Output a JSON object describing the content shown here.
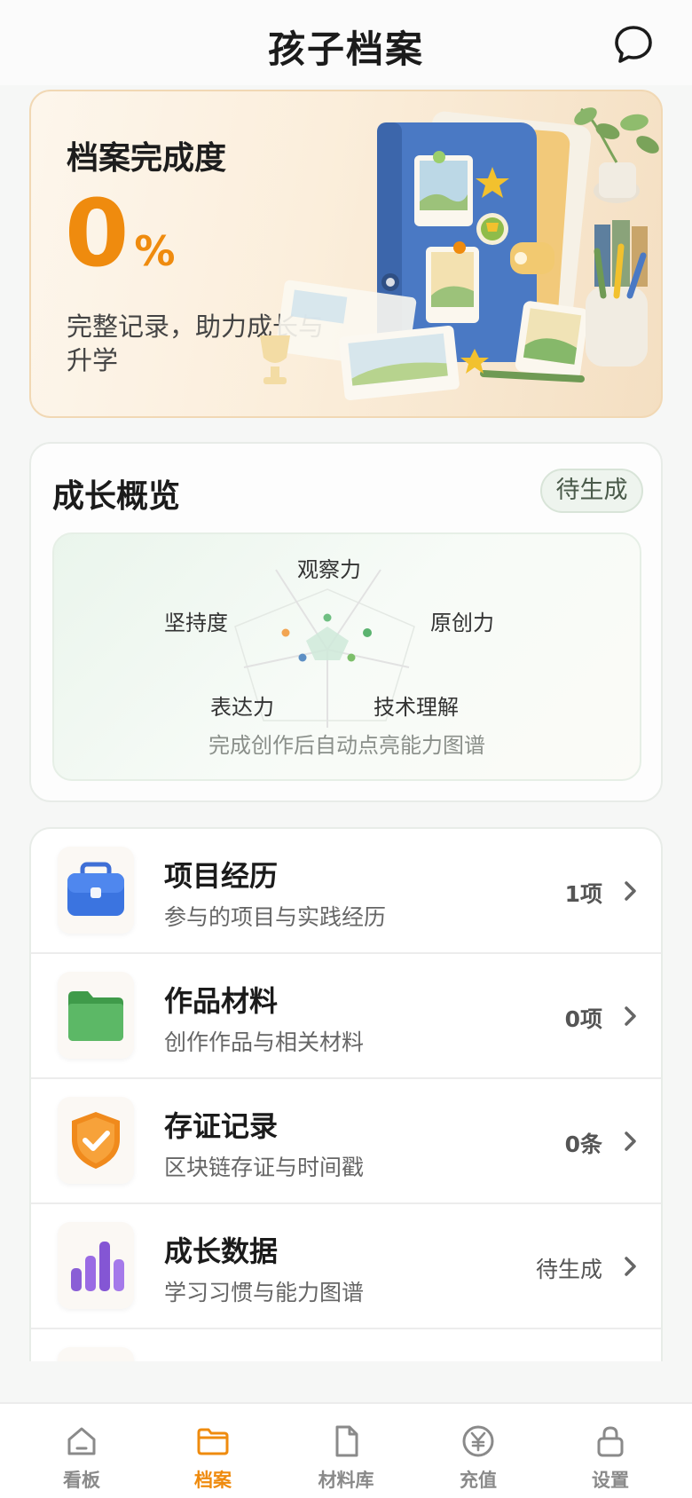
{
  "header": {
    "title": "孩子档案",
    "chat_icon": "chat-bubble-icon"
  },
  "hero": {
    "title": "档案完成度",
    "percent_value": "0",
    "percent_unit": "%",
    "progress_fraction": 0,
    "description": "完整记录，助力成长与升学",
    "accent": "#ef8b0e"
  },
  "overview": {
    "title": "成长概览",
    "badge": "待生成",
    "radar": {
      "axes": [
        "观察力",
        "原创力",
        "技术理解",
        "表达力",
        "坚持度"
      ],
      "caption": "完成创作后自动点亮能力图谱"
    }
  },
  "menu": {
    "items": [
      {
        "title": "项目经历",
        "subtitle": "参与的项目与实践经历",
        "count": "1项",
        "icon": "briefcase-icon"
      },
      {
        "title": "作品材料",
        "subtitle": "创作作品与相关材料",
        "count": "0项",
        "icon": "folder-icon"
      },
      {
        "title": "存证记录",
        "subtitle": "区块链存证与时间戳",
        "count": "0条",
        "icon": "shield-check-icon"
      },
      {
        "title": "成长数据",
        "subtitle": "学习习惯与能力图谱",
        "count": "待生成",
        "icon": "bar-chart-icon"
      }
    ]
  },
  "nav": {
    "items": [
      {
        "label": "看板",
        "icon": "home-icon"
      },
      {
        "label": "档案",
        "icon": "folder-icon"
      },
      {
        "label": "材料库",
        "icon": "document-icon"
      },
      {
        "label": "充值",
        "icon": "yuan-coin-icon"
      },
      {
        "label": "设置",
        "icon": "lock-icon"
      }
    ],
    "active_color": "#ef8b0e",
    "inactive_color": "#8a8a8a"
  }
}
